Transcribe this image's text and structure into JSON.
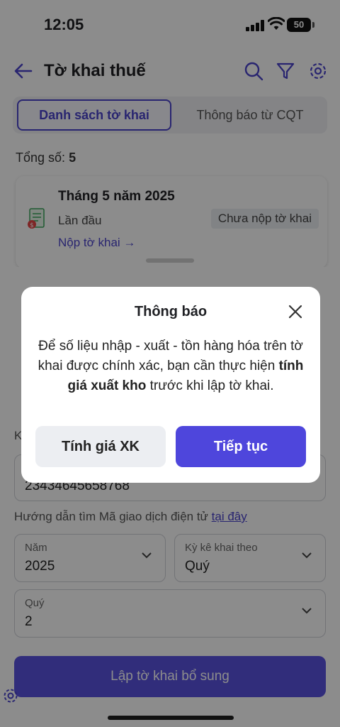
{
  "status_bar": {
    "time": "12:05",
    "battery": "50"
  },
  "header": {
    "title": "Tờ khai thuế"
  },
  "tabs": [
    {
      "label": "Danh sách tờ khai",
      "active": true
    },
    {
      "label": "Thông báo từ CQT",
      "active": false
    }
  ],
  "summary": {
    "label": "Tổng số:",
    "count": "5"
  },
  "card": {
    "title": "Tháng 5 năm 2025",
    "subtitle": "Lần đầu",
    "badge": "Chưa nộp tờ khai",
    "link": "Nộp tờ khai →"
  },
  "form": {
    "transaction_label": "K",
    "transaction_value": "23434645658768",
    "guide_text": "Hướng dẫn tìm Mã giao dịch điện tử",
    "guide_link": "tại đây",
    "year": {
      "label": "Năm",
      "value": "2025"
    },
    "period_type": {
      "label": "Kỳ kê khai theo",
      "value": "Quý"
    },
    "quarter": {
      "label": "Quý",
      "value": "2"
    },
    "submit_label": "Lập tờ khai bổ sung"
  },
  "modal": {
    "title": "Thông báo",
    "body_prefix": "Để số liệu nhập - xuất - tồn  hàng hóa trên tờ khai được chính xác, bạn cần thực hiện ",
    "body_bold": "tính giá xuất kho",
    "body_suffix": " trước khi lập tờ khai.",
    "secondary_button": "Tính giá XK",
    "primary_button": "Tiếp tục"
  },
  "colors": {
    "accent": "#4b44cc",
    "primary_button": "#4e46dc",
    "overlay": "rgba(0,0,0,0.45)"
  }
}
